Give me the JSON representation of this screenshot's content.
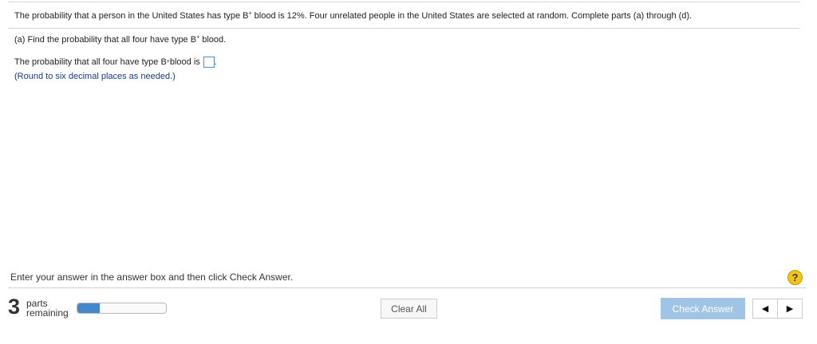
{
  "question": {
    "intro_before": "The probability that a person in the United States has type B",
    "intro_sup": "+",
    "intro_after": " blood is 12%. Four unrelated people in the United States are selected at random. Complete parts (a) through (d)."
  },
  "part_a": {
    "prompt_before": "(a) Find the probability that all four have type B",
    "prompt_sup": "+",
    "prompt_after": " blood.",
    "answer_before": "The probability that all four have type B",
    "answer_sup": "+",
    "answer_after": " blood is",
    "answer_value": "",
    "answer_end": ".",
    "hint": "(Round to six decimal places as needed.)"
  },
  "footer": {
    "instructions": "Enter your answer in the answer box and then click Check Answer.",
    "help_symbol": "?",
    "parts_count": "3",
    "parts_word": "parts",
    "remaining_word": "remaining",
    "progress_fraction": 0.25,
    "clear_label": "Clear All",
    "check_label": "Check Answer",
    "prev_symbol": "◀",
    "next_symbol": "▶"
  },
  "colors": {
    "hint": "#1a3a8a",
    "progress_fill": "#4488cc",
    "check_button": "#9fc4e6",
    "help_icon": "#f3c318"
  }
}
